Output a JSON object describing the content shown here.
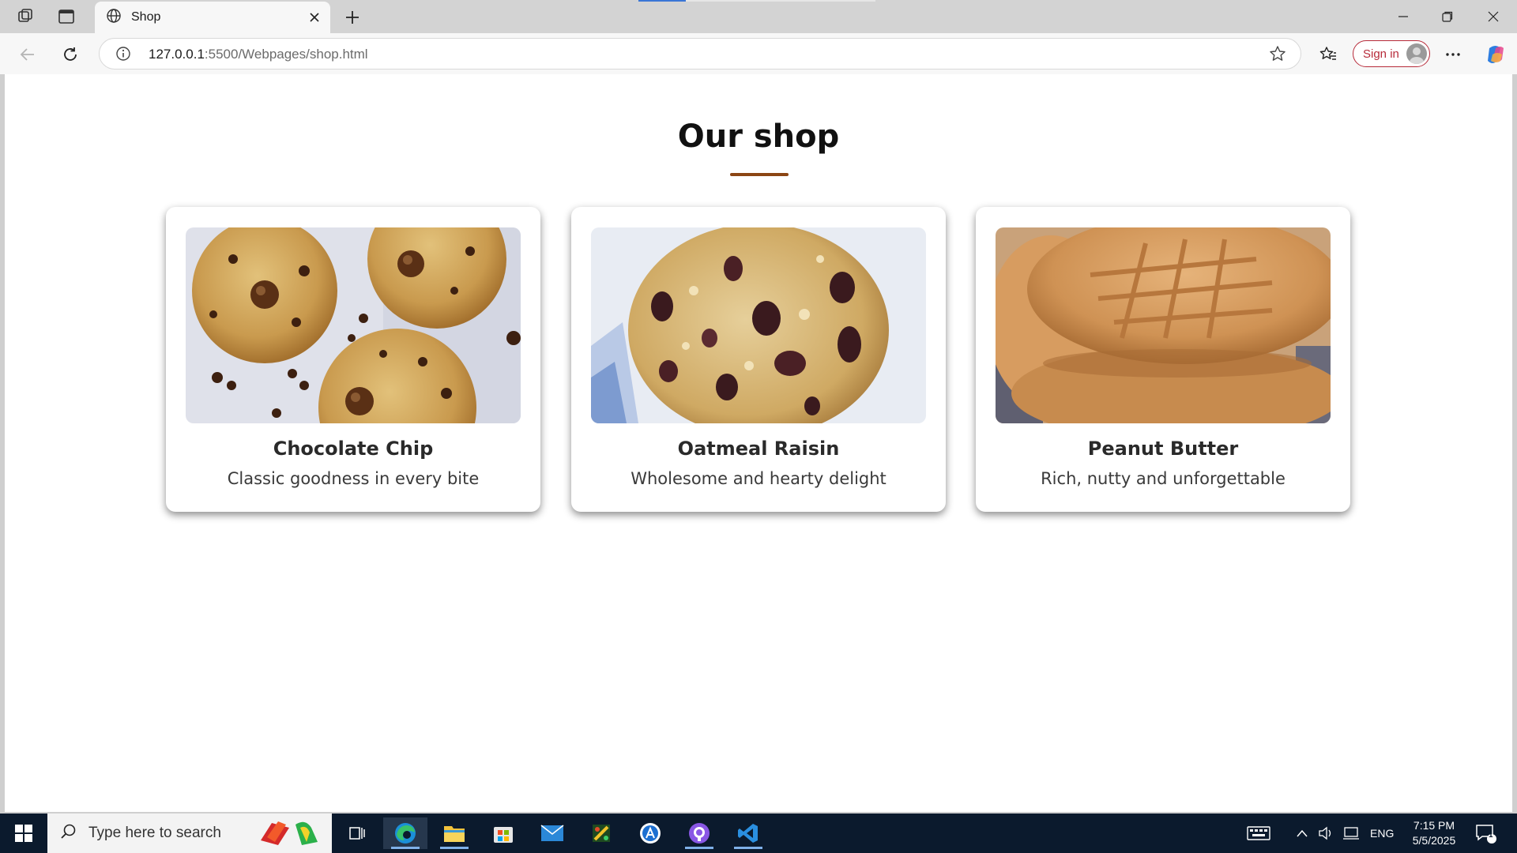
{
  "browser": {
    "tab_title": "Shop",
    "url_host": "127.0.0.1",
    "url_path": ":5500/Webpages/shop.html",
    "signin_label": "Sign in"
  },
  "page": {
    "title": "Our shop",
    "accent_color": "#8b4513",
    "products": [
      {
        "name": "Chocolate Chip",
        "description": "Classic goodness in every bite"
      },
      {
        "name": "Oatmeal Raisin",
        "description": "Wholesome and hearty delight"
      },
      {
        "name": "Peanut Butter",
        "description": "Rich, nutty and unforgettable"
      }
    ]
  },
  "taskbar": {
    "search_placeholder": "Type here to search",
    "language": "ENG",
    "time": "7:15 PM",
    "date": "5/5/2025",
    "notification_count": "1",
    "apps": [
      "edge-icon",
      "file-explorer-icon",
      "store-icon",
      "mail-icon",
      "paint-icon",
      "app-a-icon",
      "github-icon",
      "vscode-icon"
    ]
  }
}
